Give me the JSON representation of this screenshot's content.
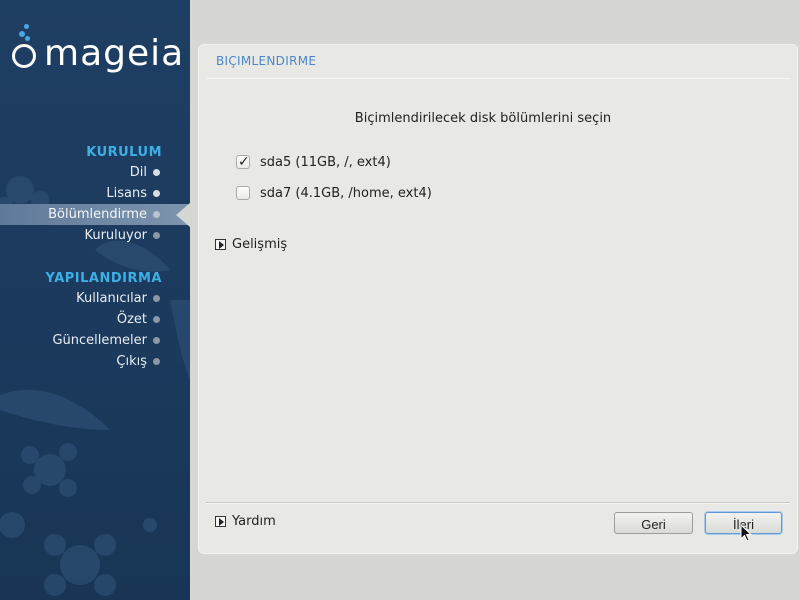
{
  "brand": {
    "logo_text": "mageia",
    "accent": "#3cb0e6"
  },
  "sidebar": {
    "sections": [
      {
        "title": "KURULUM",
        "items": [
          {
            "label": "Dil",
            "state": "done"
          },
          {
            "label": "Lisans",
            "state": "done"
          },
          {
            "label": "Bölümlendirme",
            "state": "active"
          },
          {
            "label": "Kuruluyor",
            "state": "future"
          }
        ]
      },
      {
        "title": "YAPILANDIRMA",
        "items": [
          {
            "label": "Kullanıcılar",
            "state": "future"
          },
          {
            "label": "Özet",
            "state": "future"
          },
          {
            "label": "Güncellemeler",
            "state": "future"
          },
          {
            "label": "Çıkış",
            "state": "future"
          }
        ]
      }
    ]
  },
  "panel": {
    "header": "BIÇIMLENDIRME",
    "instruction": "Biçimlendirilecek disk bölümlerini seçin",
    "partitions": [
      {
        "label": "sda5 (11GB, /, ext4)",
        "checked": true
      },
      {
        "label": "sda7 (4.1GB, /home, ext4)",
        "checked": false
      }
    ],
    "advanced_label": "Gelişmiş",
    "help_label": "Yardım",
    "back_label": "Geri",
    "next_label": "İleri"
  }
}
